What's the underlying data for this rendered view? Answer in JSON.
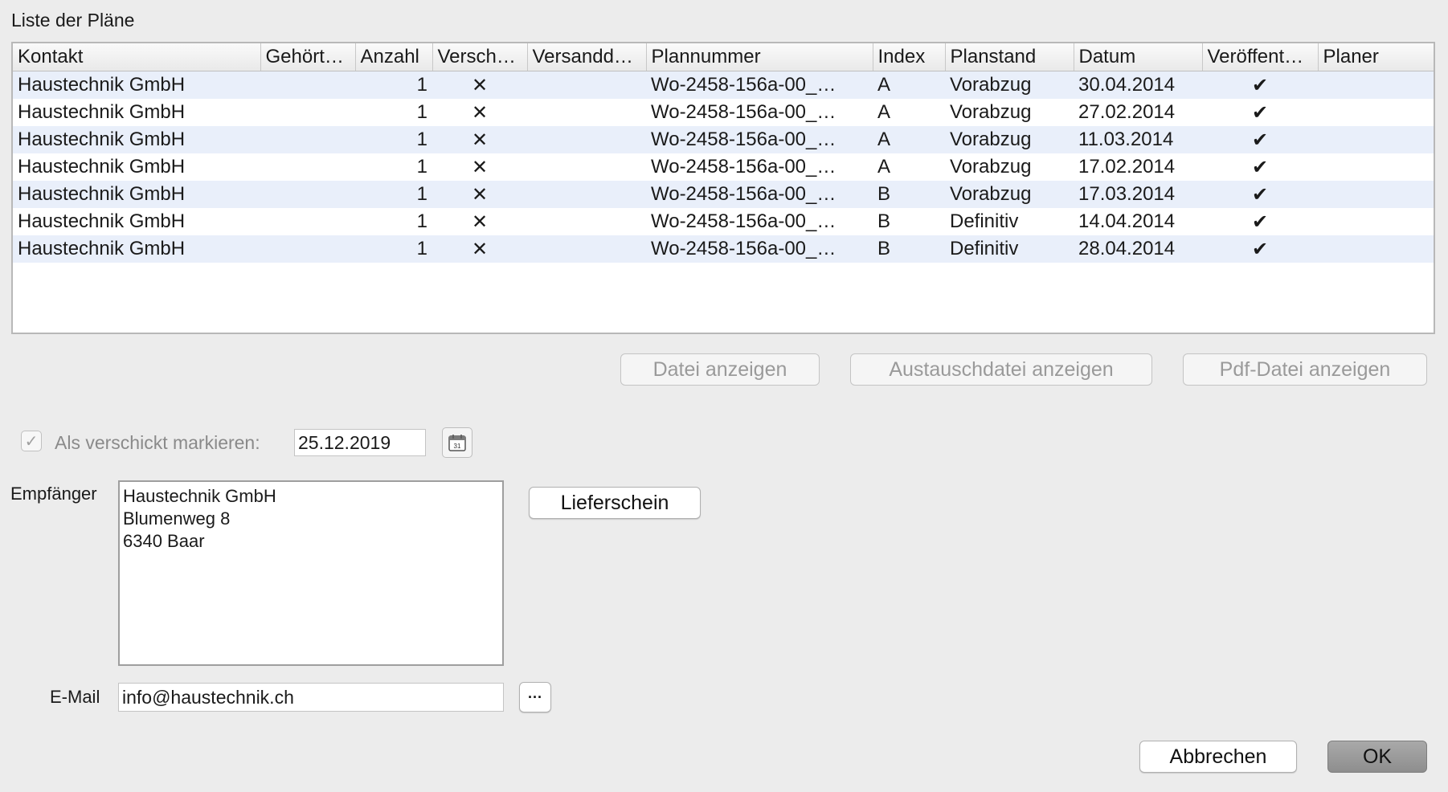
{
  "section_title": "Liste der Pläne",
  "table": {
    "columns": [
      "Kontakt",
      "Gehört…",
      "Anzahl",
      "Versch…",
      "Versandd…",
      "Plannummer",
      "Index",
      "Planstand",
      "Datum",
      "Veröffent…",
      "Planer"
    ],
    "rows": [
      {
        "kontakt": "Haustechnik GmbH",
        "gehoert": "",
        "anzahl": "1",
        "verschickt": "✕",
        "versanddatum": "",
        "plannummer": "Wo-2458-156a-00_…",
        "index": "A",
        "planstand": "Vorabzug",
        "datum": "30.04.2014",
        "veroeffentlicht": "✔",
        "planer": ""
      },
      {
        "kontakt": "Haustechnik GmbH",
        "gehoert": "",
        "anzahl": "1",
        "verschickt": "✕",
        "versanddatum": "",
        "plannummer": "Wo-2458-156a-00_…",
        "index": "A",
        "planstand": "Vorabzug",
        "datum": "27.02.2014",
        "veroeffentlicht": "✔",
        "planer": ""
      },
      {
        "kontakt": "Haustechnik GmbH",
        "gehoert": "",
        "anzahl": "1",
        "verschickt": "✕",
        "versanddatum": "",
        "plannummer": "Wo-2458-156a-00_…",
        "index": "A",
        "planstand": "Vorabzug",
        "datum": "11.03.2014",
        "veroeffentlicht": "✔",
        "planer": ""
      },
      {
        "kontakt": "Haustechnik GmbH",
        "gehoert": "",
        "anzahl": "1",
        "verschickt": "✕",
        "versanddatum": "",
        "plannummer": "Wo-2458-156a-00_…",
        "index": "A",
        "planstand": "Vorabzug",
        "datum": "17.02.2014",
        "veroeffentlicht": "✔",
        "planer": ""
      },
      {
        "kontakt": "Haustechnik GmbH",
        "gehoert": "",
        "anzahl": "1",
        "verschickt": "✕",
        "versanddatum": "",
        "plannummer": "Wo-2458-156a-00_…",
        "index": "B",
        "planstand": "Vorabzug",
        "datum": "17.03.2014",
        "veroeffentlicht": "✔",
        "planer": ""
      },
      {
        "kontakt": "Haustechnik GmbH",
        "gehoert": "",
        "anzahl": "1",
        "verschickt": "✕",
        "versanddatum": "",
        "plannummer": "Wo-2458-156a-00_…",
        "index": "B",
        "planstand": "Definitiv",
        "datum": "14.04.2014",
        "veroeffentlicht": "✔",
        "planer": ""
      },
      {
        "kontakt": "Haustechnik GmbH",
        "gehoert": "",
        "anzahl": "1",
        "verschickt": "✕",
        "versanddatum": "",
        "plannummer": "Wo-2458-156a-00_…",
        "index": "B",
        "planstand": "Definitiv",
        "datum": "28.04.2014",
        "veroeffentlicht": "✔",
        "planer": ""
      }
    ]
  },
  "file_buttons": {
    "datei": "Datei anzeigen",
    "austausch": "Austauschdatei anzeigen",
    "pdf": "Pdf-Datei anzeigen"
  },
  "sent": {
    "checked_glyph": "✓",
    "label": "Als verschickt markieren:",
    "date": "25.12.2019",
    "calendar_day": "31"
  },
  "recipient": {
    "label": "Empfänger",
    "lines": [
      "Haustechnik GmbH",
      "Blumenweg 8",
      "6340 Baar"
    ],
    "delivery_button": "Lieferschein"
  },
  "email": {
    "label": "E-Mail",
    "value": "info@haustechnik.ch",
    "more_button": "···"
  },
  "footer": {
    "cancel": "Abbrechen",
    "ok": "OK"
  }
}
